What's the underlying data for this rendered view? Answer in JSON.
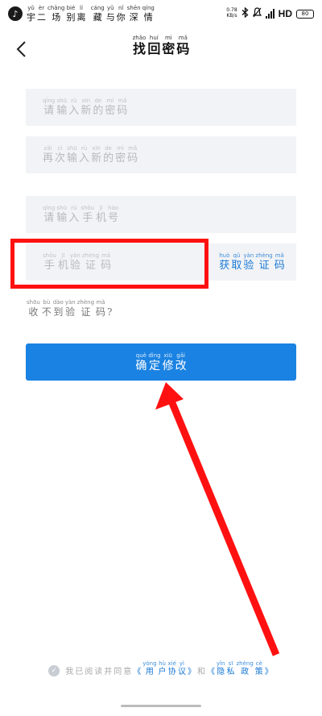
{
  "status_bar": {
    "song": [
      {
        "c": "宇",
        "r": "yǔ"
      },
      {
        "c": "二",
        "r": "èr"
      },
      {
        "c": "场",
        "r": "chǎng"
      },
      {
        "c": "别",
        "r": "bié"
      },
      {
        "c": "离",
        "r": "lí"
      },
      {
        "c": " ",
        "r": ""
      },
      {
        "c": "藏",
        "r": "cáng"
      },
      {
        "c": "与",
        "r": "yǔ"
      },
      {
        "c": "你",
        "r": "nǐ"
      },
      {
        "c": "深",
        "r": "shēn"
      },
      {
        "c": "情",
        "r": "qíng"
      }
    ],
    "net_speed": "0.78",
    "net_unit": "KB/s",
    "signal_label": "HD",
    "battery": "80"
  },
  "header": {
    "title": [
      {
        "c": "找",
        "r": "zhǎo"
      },
      {
        "c": "回",
        "r": "huí"
      },
      {
        "c": "密",
        "r": "mì"
      },
      {
        "c": "码",
        "r": "mǎ"
      }
    ]
  },
  "form": {
    "new_password_placeholder": [
      {
        "c": "请",
        "r": "qǐng"
      },
      {
        "c": "输",
        "r": "shū"
      },
      {
        "c": "入",
        "r": "rù"
      },
      {
        "c": "新",
        "r": "xīn"
      },
      {
        "c": "的",
        "r": "de"
      },
      {
        "c": "密",
        "r": "mì"
      },
      {
        "c": "码",
        "r": "mǎ"
      }
    ],
    "confirm_password_placeholder": [
      {
        "c": "再",
        "r": "zài"
      },
      {
        "c": "次",
        "r": "cì"
      },
      {
        "c": "输",
        "r": "shū"
      },
      {
        "c": "入",
        "r": "rù"
      },
      {
        "c": "新",
        "r": "xīn"
      },
      {
        "c": "的",
        "r": "de"
      },
      {
        "c": "密",
        "r": "mì"
      },
      {
        "c": "码",
        "r": "mǎ"
      }
    ],
    "phone_placeholder": [
      {
        "c": "请",
        "r": "qǐng"
      },
      {
        "c": "输",
        "r": "shū"
      },
      {
        "c": "入",
        "r": "rù"
      },
      {
        "c": "手",
        "r": "shǒu"
      },
      {
        "c": "机",
        "r": "jī"
      },
      {
        "c": "号",
        "r": "hào"
      }
    ],
    "code_placeholder": [
      {
        "c": "手",
        "r": "shǒu"
      },
      {
        "c": "机",
        "r": "jī"
      },
      {
        "c": "验",
        "r": "yàn"
      },
      {
        "c": "证",
        "r": "zhèng"
      },
      {
        "c": "码",
        "r": "mǎ"
      }
    ],
    "get_code_label": [
      {
        "c": "获",
        "r": "huò"
      },
      {
        "c": "取",
        "r": "qǔ"
      },
      {
        "c": "验",
        "r": "yàn"
      },
      {
        "c": "证",
        "r": "zhèng"
      },
      {
        "c": "码",
        "r": "mǎ"
      }
    ],
    "no_code_label": [
      {
        "c": "收",
        "r": "shōu"
      },
      {
        "c": "不",
        "r": "bù"
      },
      {
        "c": "到",
        "r": "dào"
      },
      {
        "c": "验",
        "r": "yàn"
      },
      {
        "c": "证",
        "r": "zhèng"
      },
      {
        "c": "码",
        "r": "mǎ"
      },
      {
        "c": "?",
        "r": ""
      }
    ],
    "confirm_label": [
      {
        "c": "确",
        "r": "què"
      },
      {
        "c": "定",
        "r": "dìng"
      },
      {
        "c": "修",
        "r": "xiū"
      },
      {
        "c": "改",
        "r": "gǎi"
      }
    ]
  },
  "agreement": {
    "prefix": [
      {
        "c": "我",
        "r": ""
      },
      {
        "c": "已",
        "r": ""
      },
      {
        "c": "阅",
        "r": ""
      },
      {
        "c": "读",
        "r": ""
      },
      {
        "c": "并",
        "r": ""
      },
      {
        "c": "同",
        "r": ""
      },
      {
        "c": "意",
        "r": ""
      }
    ],
    "user_agreement": [
      {
        "c": "《",
        "r": ""
      },
      {
        "c": "用",
        "r": "yòng"
      },
      {
        "c": "户",
        "r": "hù"
      },
      {
        "c": "协",
        "r": "xié"
      },
      {
        "c": "议",
        "r": "yì"
      },
      {
        "c": "》",
        "r": ""
      }
    ],
    "and": [
      {
        "c": "和",
        "r": ""
      }
    ],
    "privacy_policy": [
      {
        "c": "《",
        "r": ""
      },
      {
        "c": "隐",
        "r": "yǐn"
      },
      {
        "c": "私",
        "r": "sī"
      },
      {
        "c": "政",
        "r": "zhèng"
      },
      {
        "c": "策",
        "r": "cè"
      },
      {
        "c": "》",
        "r": ""
      }
    ]
  },
  "colors": {
    "accent": "#1a82e2",
    "link": "#1a7ad6",
    "annotation": "#ff1111"
  }
}
